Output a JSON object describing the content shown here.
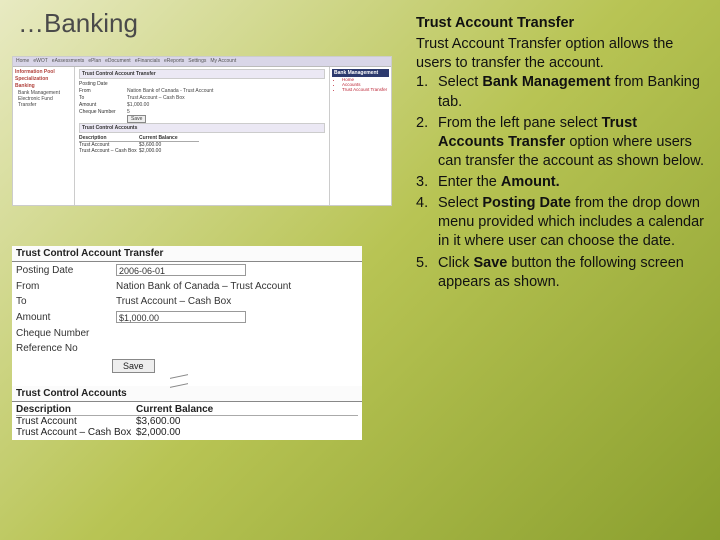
{
  "slide_title": "…Banking",
  "instructions": {
    "heading": "Trust Account Transfer",
    "intro": "Trust Account Transfer option allows the users to transfer the account.",
    "steps": [
      {
        "n": "1.",
        "pre": "Select ",
        "bold": "Bank Management",
        "post": " from Banking tab."
      },
      {
        "n": "2.",
        "pre": "From the left pane select ",
        "bold": "Trust Accounts Transfer",
        "post": " option where users can transfer the account as shown below."
      },
      {
        "n": "3.",
        "pre": "Enter the ",
        "bold": "Amount.",
        "post": ""
      },
      {
        "n": "4.",
        "pre": "Select ",
        "bold": "Posting Date",
        "post": " from the drop down menu provided which includes a calendar in it where user can choose the date."
      },
      {
        "n": "5.",
        "pre": "Click ",
        "bold": "Save",
        "post": " button the following screen appears as shown."
      }
    ]
  },
  "mini": {
    "tabs": [
      "Home",
      "eWOT",
      "eAssessments",
      "ePlan",
      "eDocument",
      "eFinancials",
      "eReports",
      "Settings",
      "My Account"
    ],
    "left": {
      "h1": "Information Pool",
      "h2": "Specialization",
      "h3": "Banking",
      "items": [
        "Bank Management",
        "Electronic Fund Transfer"
      ]
    },
    "mid": {
      "title": "Trust Control Account Transfer",
      "rows": [
        {
          "lbl": "Posting Date",
          "val": ""
        },
        {
          "lbl": "From",
          "val": "Nation Bank of Canada - Trust Account"
        },
        {
          "lbl": "To",
          "val": "Trust Account – Cash Box"
        },
        {
          "lbl": "Amount",
          "val": "$1,000.00"
        },
        {
          "lbl": "Cheque Number",
          "val": "5"
        }
      ],
      "save": "Save",
      "tbl_title": "Trust Control Accounts",
      "tbl": {
        "headers": [
          "Description",
          "Current Balance"
        ],
        "rows": [
          [
            "Trust Account",
            "$3,600.00"
          ],
          [
            "Trust Account – Cash Box",
            "$2,000.00"
          ]
        ]
      }
    },
    "right": {
      "header": "Bank Management",
      "items": [
        "Home",
        "Accounts",
        "Trust Account Transfer"
      ]
    }
  },
  "form": {
    "section1": "Trust Control Account Transfer",
    "rows": [
      {
        "lbl": "Posting Date",
        "val": "2006-06-01"
      },
      {
        "lbl": "From",
        "val": "Nation Bank of Canada – Trust Account"
      },
      {
        "lbl": "To",
        "val": "Trust Account – Cash Box"
      },
      {
        "lbl": "Amount",
        "val": "$1,000.00"
      },
      {
        "lbl": "Cheque Number",
        "val": ""
      },
      {
        "lbl": "Reference No",
        "val": ""
      }
    ],
    "save": "Save",
    "section2": "Trust Control Accounts",
    "tbl": {
      "headers": [
        "Description",
        "Current Balance"
      ],
      "rows": [
        [
          "Trust Account",
          "$3,600.00"
        ],
        [
          "Trust Account – Cash Box",
          "$2,000.00"
        ]
      ]
    }
  }
}
